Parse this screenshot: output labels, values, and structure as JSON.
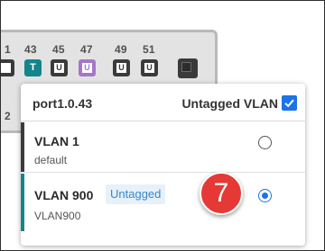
{
  "switch": {
    "port_numbers": [
      "1",
      "43",
      "45",
      "47",
      "49",
      "51"
    ],
    "side_label": "2",
    "ports": [
      {
        "letter": "",
        "style": "plain"
      },
      {
        "letter": "T",
        "style": "teal"
      },
      {
        "letter": "U",
        "style": "plain"
      },
      {
        "letter": "U",
        "style": "purple"
      },
      {
        "letter": "U",
        "style": "plain"
      },
      {
        "letter": "U",
        "style": "plain"
      },
      {
        "letter": "",
        "style": "empty"
      }
    ]
  },
  "popup": {
    "port_name": "port1.0.43",
    "untagged_vlan_label": "Untagged VLAN",
    "untagged_vlan_checked": true,
    "vlans": [
      {
        "name": "VLAN 1",
        "description": "default",
        "badge": "",
        "selected": false
      },
      {
        "name": "VLAN 900",
        "description": "VLAN900",
        "badge": "Untagged",
        "selected": true
      }
    ]
  },
  "annotation": {
    "step": "7"
  },
  "colors": {
    "accent": "#1a73e8",
    "teal": "#14858a",
    "marker": "#e53935",
    "purple": "#a676c7"
  }
}
